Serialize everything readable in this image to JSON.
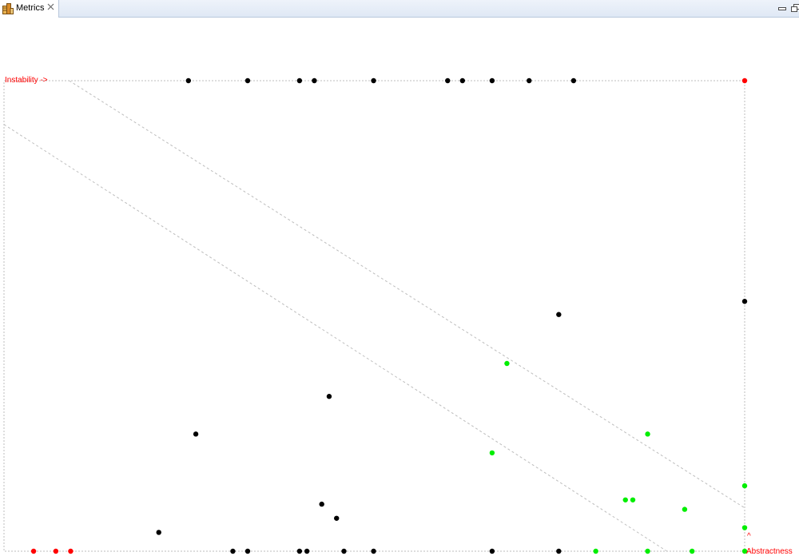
{
  "view": {
    "tab_title": "Metrics",
    "tab_icon": "metrics-icon",
    "close_icon": "close-icon",
    "minimize_icon": "minimize-icon",
    "restore_icon": "restore-icon"
  },
  "colors": {
    "label": "#ff0000",
    "point_normal": "#000000",
    "point_good": "#00ee00",
    "point_warning": "#ff0000",
    "guide_line": "#bdbdbd"
  },
  "chart_data": {
    "type": "scatter",
    "x_label": "Instability ->",
    "y_label_marker": "^",
    "y_label": "Abstractness",
    "xlim": [
      0,
      1
    ],
    "ylim": [
      0,
      1
    ],
    "guide_lines": [
      {
        "name": "",
        "points": [
          [
            0.088,
            1.0
          ],
          [
            1.0,
            0.092
          ]
        ]
      },
      {
        "name": "",
        "points": [
          [
            0.0,
            0.907
          ],
          [
            0.895,
            0.0
          ]
        ]
      }
    ],
    "series": [
      {
        "category": "normal",
        "points": [
          [
            0.249,
            1.0
          ],
          [
            0.329,
            1.0
          ],
          [
            0.399,
            1.0
          ],
          [
            0.419,
            1.0
          ],
          [
            0.499,
            1.0
          ],
          [
            0.599,
            1.0
          ],
          [
            0.619,
            1.0
          ],
          [
            0.659,
            1.0
          ],
          [
            0.709,
            1.0
          ],
          [
            0.769,
            1.0
          ],
          [
            1.0,
            0.531
          ],
          [
            0.749,
            0.503
          ],
          [
            0.439,
            0.329
          ],
          [
            0.259,
            0.249
          ],
          [
            0.429,
            0.1
          ],
          [
            0.449,
            0.07
          ],
          [
            0.209,
            0.04
          ],
          [
            0.309,
            0.0
          ],
          [
            0.329,
            0.0
          ],
          [
            0.399,
            0.0
          ],
          [
            0.409,
            0.0
          ],
          [
            0.459,
            0.0
          ],
          [
            0.499,
            0.0
          ],
          [
            0.659,
            0.0
          ],
          [
            0.749,
            0.0
          ]
        ]
      },
      {
        "category": "good",
        "points": [
          [
            0.679,
            0.399
          ],
          [
            0.869,
            0.249
          ],
          [
            0.659,
            0.209
          ],
          [
            1.0,
            0.139
          ],
          [
            0.839,
            0.109
          ],
          [
            0.849,
            0.109
          ],
          [
            0.919,
            0.089
          ],
          [
            1.0,
            0.05
          ],
          [
            0.799,
            0.0
          ],
          [
            0.869,
            0.0
          ],
          [
            0.929,
            0.0
          ],
          [
            1.0,
            0.0
          ]
        ]
      },
      {
        "category": "warning",
        "points": [
          [
            1.0,
            1.0
          ],
          [
            0.04,
            0.0
          ],
          [
            0.07,
            0.0
          ],
          [
            0.09,
            0.0
          ]
        ]
      }
    ]
  }
}
